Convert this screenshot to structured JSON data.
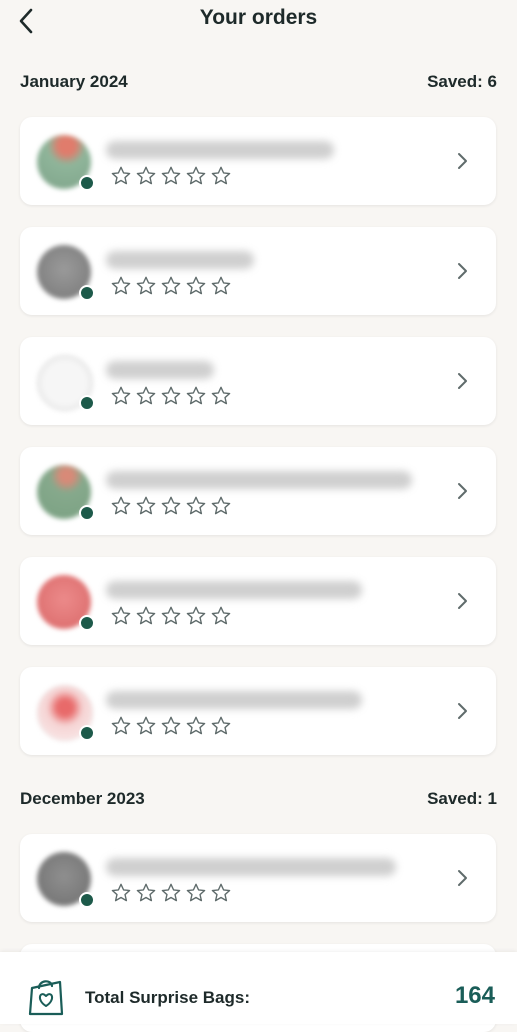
{
  "header": {
    "title": "Your orders",
    "back_icon": "chevron-left-icon"
  },
  "sections": [
    {
      "month": "January 2024",
      "saved": "Saved: 6",
      "orders": [
        {
          "avatar_color": "#8fb59a",
          "rating": 0
        },
        {
          "avatar_color": "#8a8a8a",
          "rating": 0
        },
        {
          "avatar_color": "#e6e6e6",
          "rating": 0
        },
        {
          "avatar_color": "#86a98c",
          "rating": 0
        },
        {
          "avatar_color": "#e07a7a",
          "rating": 0
        },
        {
          "avatar_color": "#f1c4c4",
          "rating": 0
        }
      ]
    },
    {
      "month": "December 2023",
      "saved": "Saved: 1",
      "orders": [
        {
          "avatar_color": "#7f7f7f",
          "rating": 0
        }
      ]
    }
  ],
  "footer": {
    "label": "Total Surprise Bags:",
    "count": "164",
    "icon": "shopping-bag-icon",
    "accent": "#1a5d58"
  },
  "colors": {
    "badge": "#1d5a4a",
    "star_outline": "#5f6b6b"
  }
}
